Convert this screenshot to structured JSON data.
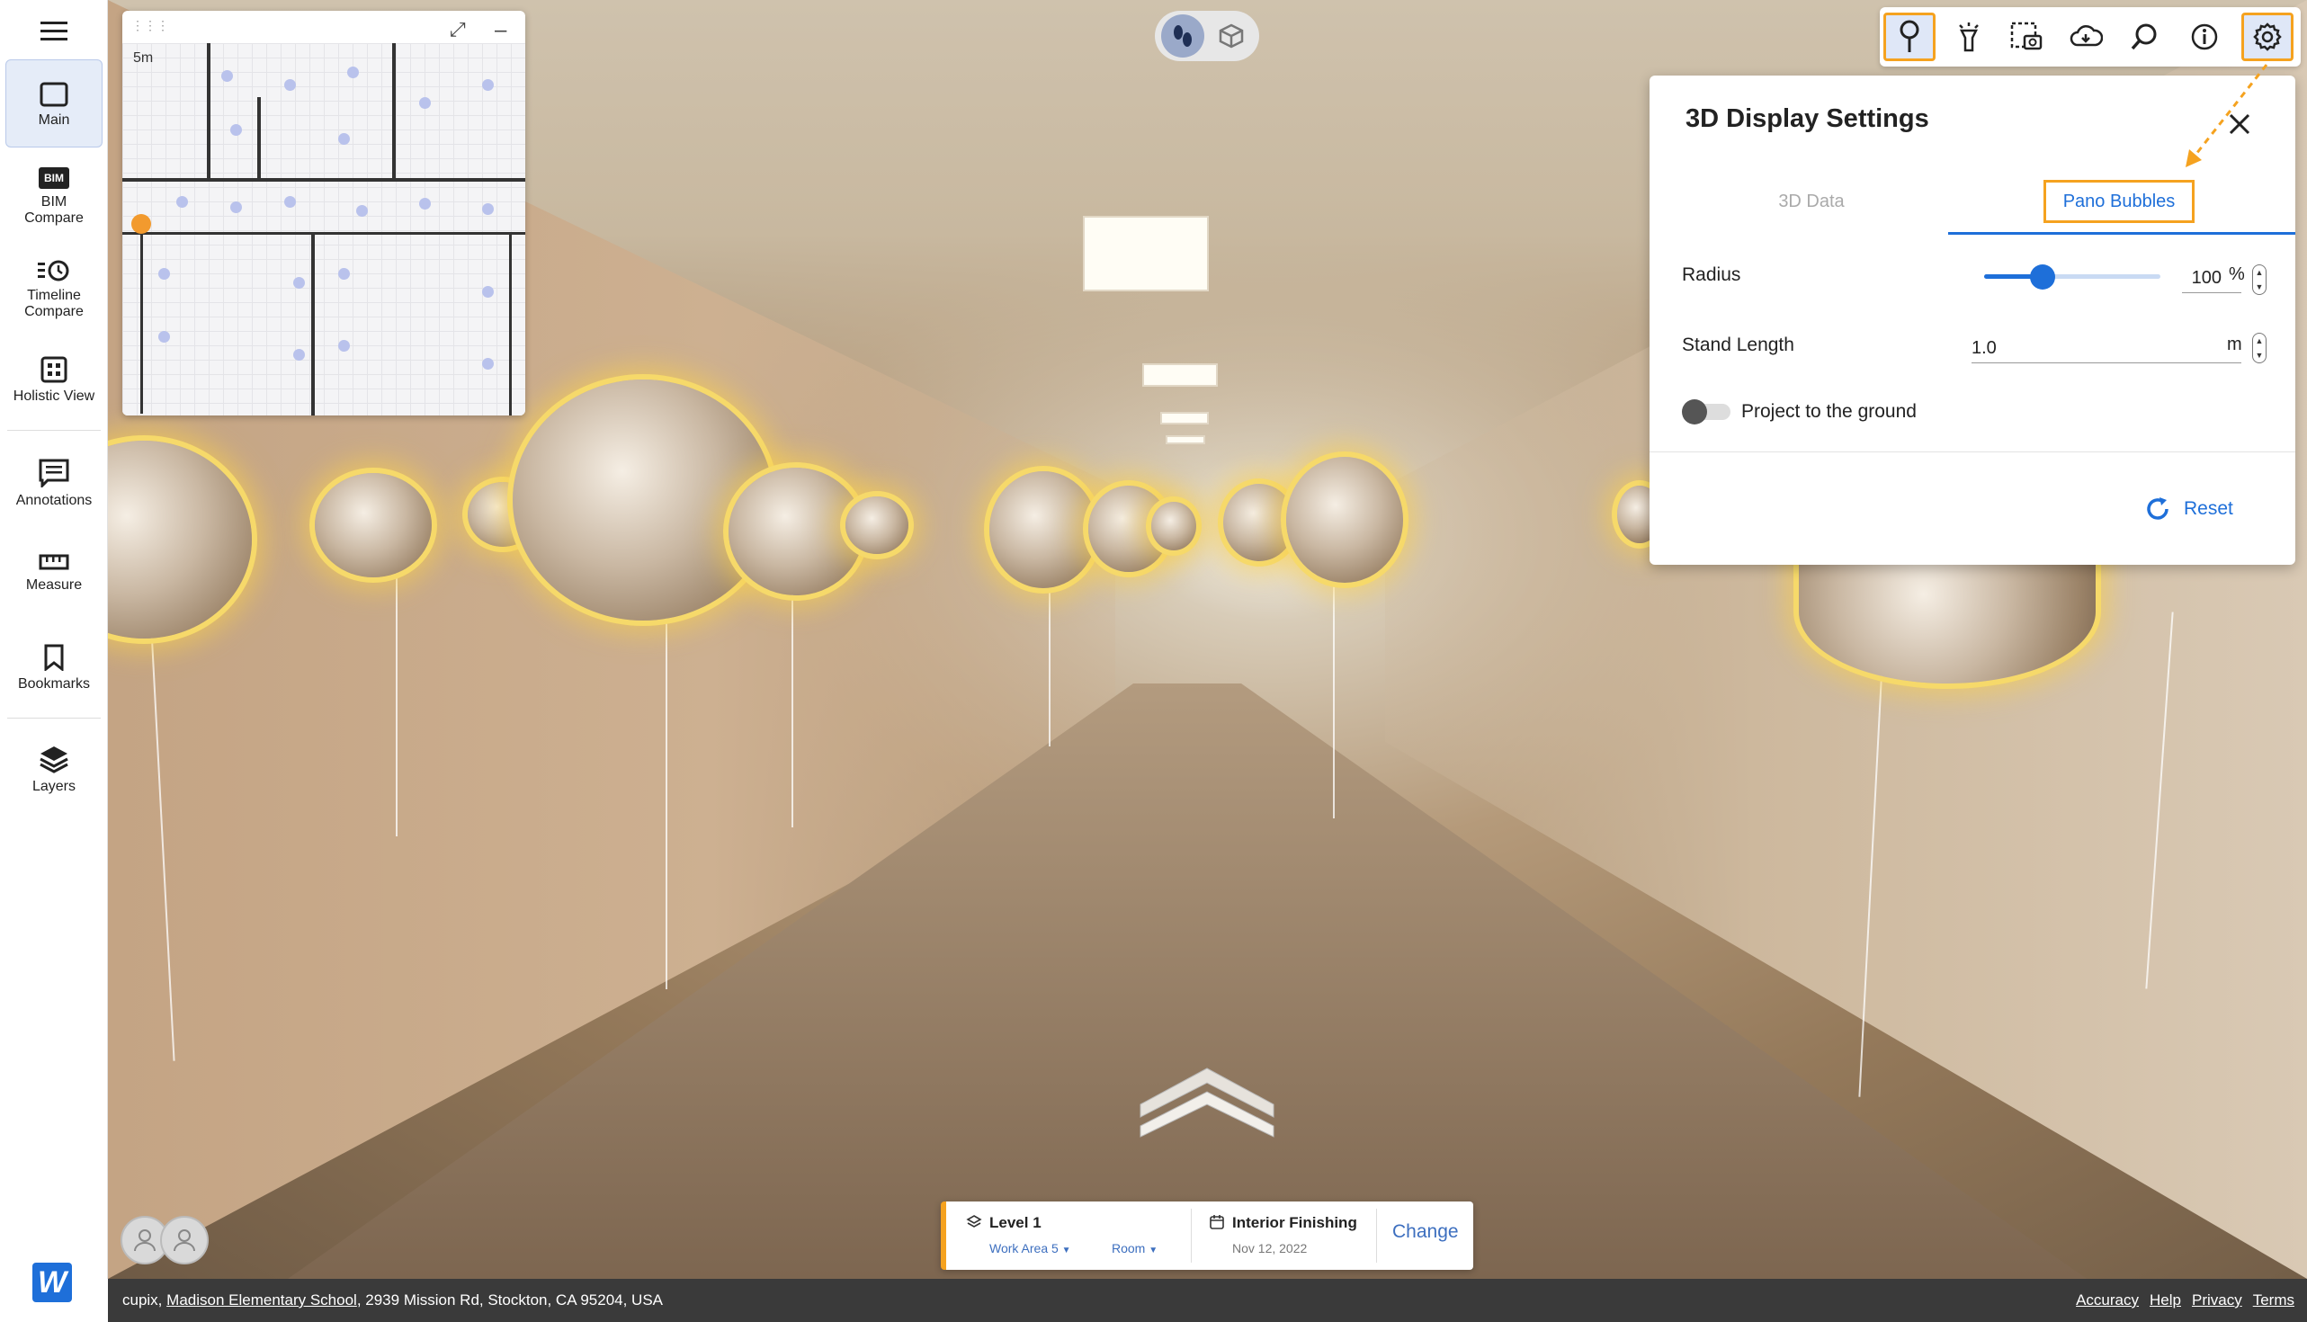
{
  "sidebar": {
    "items": [
      {
        "label": "Main",
        "icon": "square-icon"
      },
      {
        "label": "BIM Compare",
        "icon": "bim-icon",
        "badge": "BIM"
      },
      {
        "label": "Timeline Compare",
        "icon": "timeline-icon"
      },
      {
        "label": "Holistic View",
        "icon": "grid-icon"
      },
      {
        "label": "Annotations",
        "icon": "annotation-icon"
      },
      {
        "label": "Measure",
        "icon": "ruler-icon"
      },
      {
        "label": "Bookmarks",
        "icon": "bookmark-icon"
      },
      {
        "label": "Layers",
        "icon": "layers-icon"
      }
    ],
    "brand_letter": "W"
  },
  "minimap": {
    "scale_label": "5m"
  },
  "settings_panel": {
    "title": "3D Display Settings",
    "tabs": [
      {
        "label": "3D Data",
        "active": false
      },
      {
        "label": "Pano Bubbles",
        "active": true
      }
    ],
    "radius": {
      "label": "Radius",
      "value": "100",
      "unit": "%",
      "slider_fraction": 0.33
    },
    "stand_length": {
      "label": "Stand Length",
      "value": "1.0",
      "unit": "m"
    },
    "project_toggle": {
      "label": "Project to the ground",
      "on": false
    },
    "reset_label": "Reset"
  },
  "level_bar": {
    "level": "Level 1",
    "work_area": "Work Area 5",
    "room": "Room",
    "phase": "Interior Finishing",
    "date": "Nov 12, 2022",
    "change_label": "Change"
  },
  "footer": {
    "prefix": "cupix,",
    "project": "Madison Elementary School",
    "address": ", 2939 Mission Rd, Stockton, CA 95204, USA",
    "links": [
      "Accuracy",
      "Help",
      "Privacy",
      "Terms"
    ]
  },
  "colors": {
    "accent": "#1e6fd9",
    "highlight": "#f5a21f",
    "footer_bg": "#3a3a3a",
    "bubble_glow": "#f6d96a"
  }
}
